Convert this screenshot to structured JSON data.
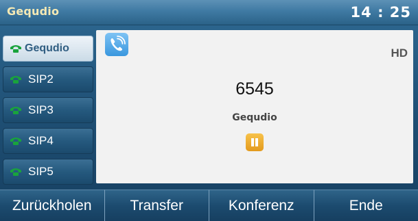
{
  "topbar": {
    "brand": "Gequdio",
    "time": "14 : 25"
  },
  "accounts": [
    {
      "label": "Gequdio",
      "active": true,
      "icon": "phone-handset-icon"
    },
    {
      "label": "SIP2",
      "active": false,
      "icon": "phone-handset-icon"
    },
    {
      "label": "SIP3",
      "active": false,
      "icon": "phone-handset-icon"
    },
    {
      "label": "SIP4",
      "active": false,
      "icon": "phone-handset-icon"
    },
    {
      "label": "SIP5",
      "active": false,
      "icon": "phone-handset-icon"
    }
  ],
  "call": {
    "status_icon": "call-active-icon",
    "quality": "HD",
    "number": "6545",
    "name": "Gequdio",
    "hold_icon": "pause-icon"
  },
  "softkeys": [
    {
      "label": "Zurückholen"
    },
    {
      "label": "Transfer"
    },
    {
      "label": "Konferenz"
    },
    {
      "label": "Ende"
    }
  ],
  "colors": {
    "accent_green": "#19a33c",
    "hold_orange": "#e8a020",
    "call_blue": "#3a97de"
  }
}
